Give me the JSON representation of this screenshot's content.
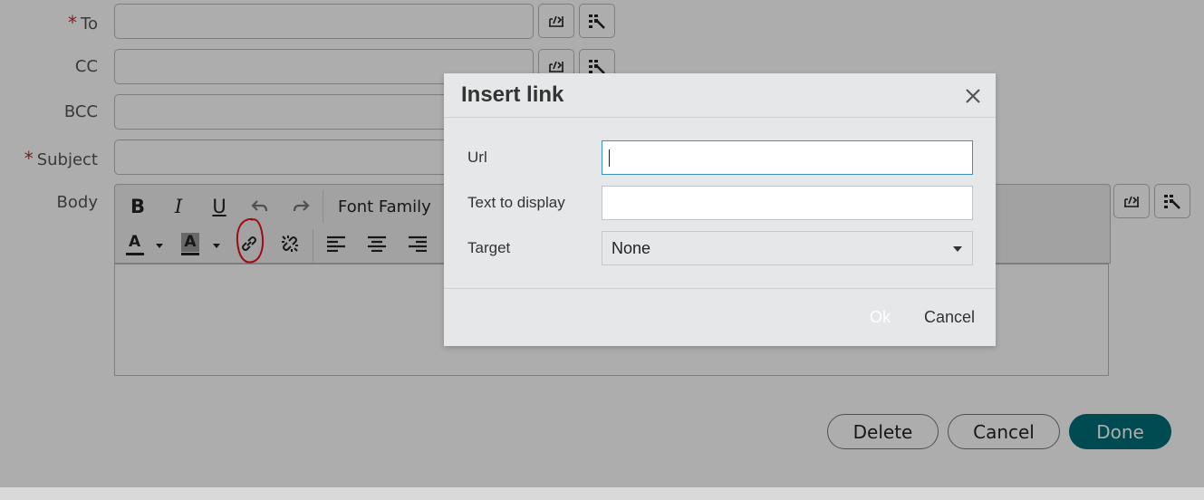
{
  "form": {
    "to_label": "To",
    "cc_label": "CC",
    "bcc_label": "BCC",
    "subject_label": "Subject",
    "body_label": "Body",
    "required_mark": "*"
  },
  "toolbar": {
    "bold": "B",
    "italic": "I",
    "underline": "U",
    "font_family": "Font Family",
    "font_color_letter": "A",
    "bg_color_letter": "A"
  },
  "actions": {
    "delete": "Delete",
    "cancel": "Cancel",
    "done": "Done"
  },
  "dialog": {
    "title": "Insert link",
    "url_label": "Url",
    "url_value": "",
    "text_label": "Text to display",
    "text_value": "",
    "target_label": "Target",
    "target_value": "None",
    "ok": "Ok",
    "cancel": "Cancel"
  },
  "colors": {
    "primary": "#006d7a",
    "required": "#b43030",
    "annotation": "#e8141b"
  }
}
